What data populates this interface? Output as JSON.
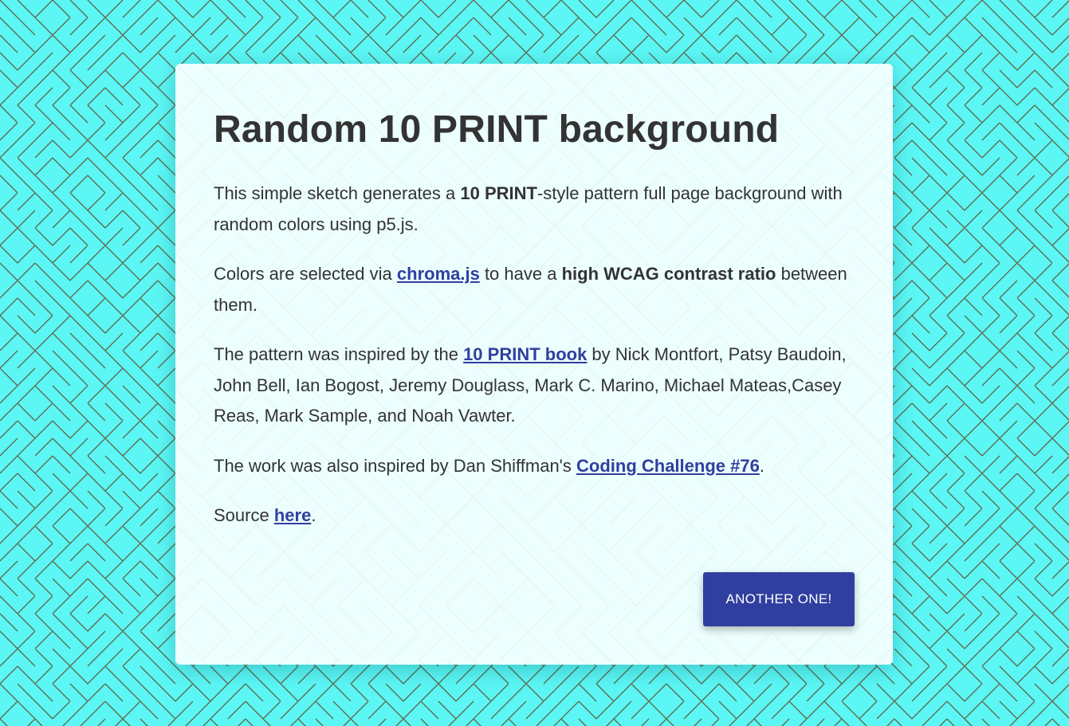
{
  "colors": {
    "background": "#5cf7f5",
    "pattern_line": "#5f6b4f",
    "card_background": "#ecfefd",
    "text": "#333333",
    "link": "#303f9f",
    "button": "#303f9f",
    "button_text": "#ffffff"
  },
  "card": {
    "title": "Random 10 PRINT background",
    "paragraph1": {
      "before": "This simple sketch generates a ",
      "bold": "10 PRINT",
      "after": "-style pattern full page background with random colors using p5.js."
    },
    "paragraph2": {
      "before": "Colors are selected via ",
      "link": "chroma.js",
      "middle": " to have a ",
      "bold": "high WCAG contrast ratio",
      "after": " between them."
    },
    "paragraph3": {
      "before": "The pattern was inspired by the ",
      "link": "10 PRINT book",
      "after": " by Nick Montfort, Patsy Baudoin, John Bell, Ian Bogost, Jeremy Douglass, Mark C. Marino, Michael Mateas,Casey Reas, Mark Sample, and Noah Vawter."
    },
    "paragraph4": {
      "before": "The work was also inspired by Dan Shiffman's ",
      "link": "Coding Challenge #76",
      "after": "."
    },
    "paragraph5": {
      "before": "Source ",
      "link": "here",
      "after": "."
    },
    "button_label": "ANOTHER ONE!"
  }
}
